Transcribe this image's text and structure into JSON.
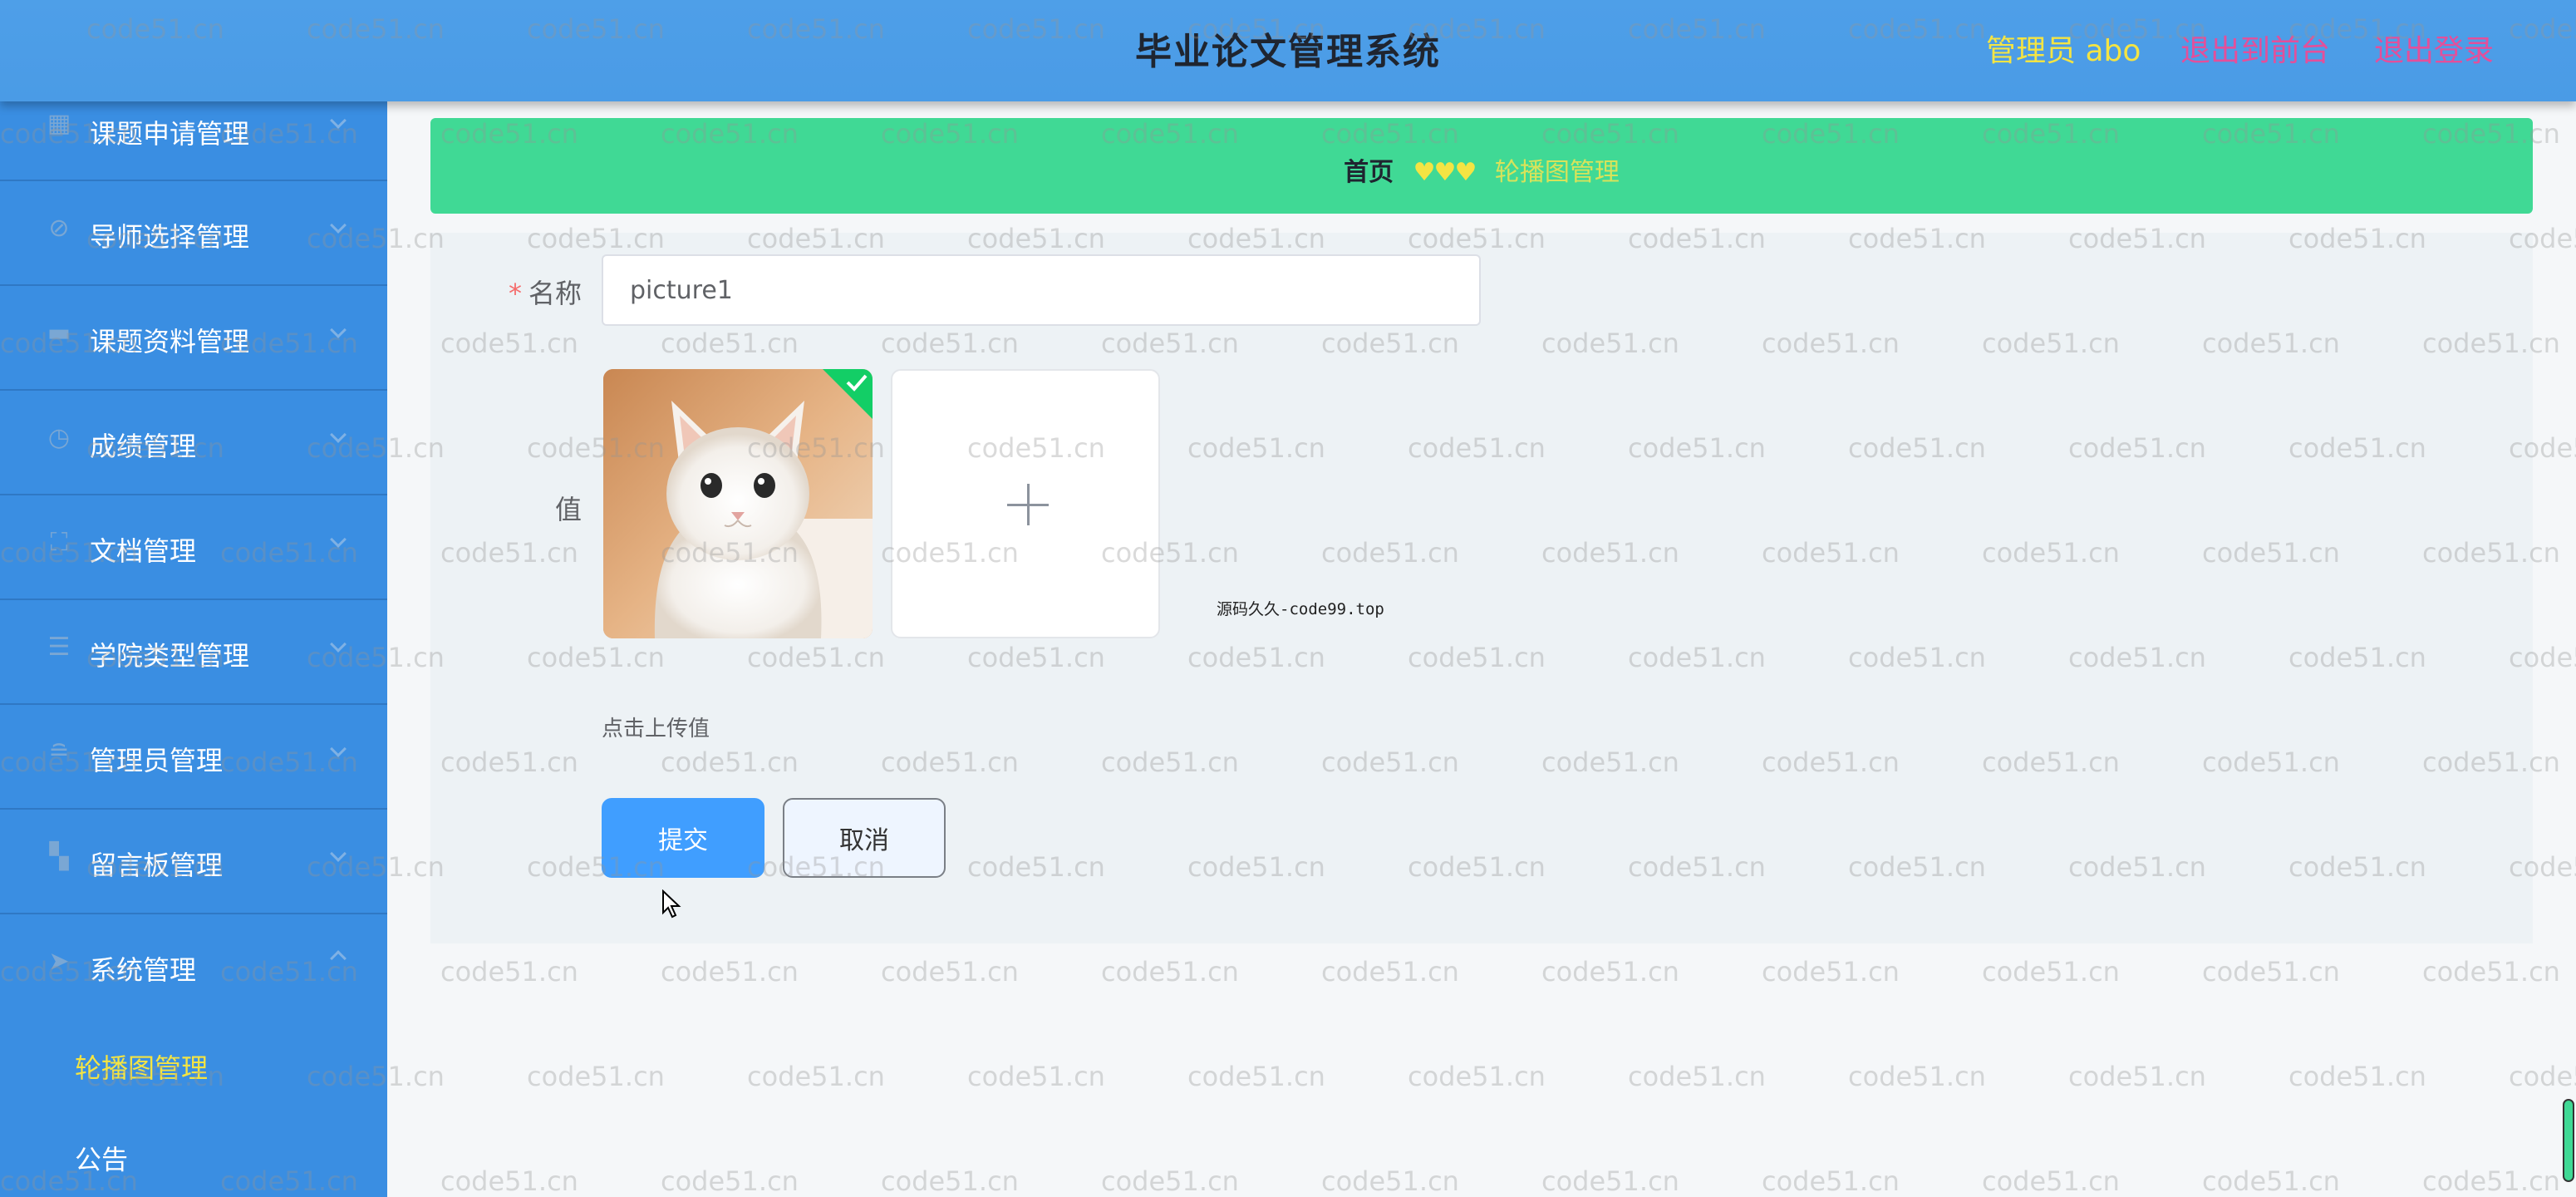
{
  "header": {
    "title": "毕业论文管理系统",
    "user": "管理员 abo",
    "back_front": "退出到前台",
    "logout": "退出登录"
  },
  "sidebar": {
    "items": [
      {
        "label": "课题申请管理",
        "icon": "building-icon"
      },
      {
        "label": "导师选择管理",
        "icon": "compass-icon"
      },
      {
        "label": "课题资料管理",
        "icon": "folder-icon"
      },
      {
        "label": "成绩管理",
        "icon": "clock-icon"
      },
      {
        "label": "文档管理",
        "icon": "document-icon"
      },
      {
        "label": "学院类型管理",
        "icon": "list-icon"
      },
      {
        "label": "管理员管理",
        "icon": "sliders-icon"
      },
      {
        "label": "留言板管理",
        "icon": "grid-icon"
      },
      {
        "label": "系统管理",
        "icon": "send-icon"
      }
    ],
    "submenu": [
      {
        "label": "轮播图管理",
        "active": true
      },
      {
        "label": "公告",
        "active": false
      }
    ]
  },
  "breadcrumb": {
    "home": "首页",
    "separator": "♥♥♥",
    "current": "轮播图管理"
  },
  "form": {
    "name_label": "名称",
    "required_mark": "*",
    "name_value": "picture1",
    "value_label": "值",
    "hint": "点击上传值",
    "source_note": "源码久久-code99.top",
    "submit": "提交",
    "cancel": "取消"
  },
  "watermark": "code51.cn",
  "colors": {
    "header": "#4a9be6",
    "sidebar": "#3a8ee2",
    "breadcrumb": "#40d995",
    "accent_yellow": "#f4e443",
    "accent_pink": "#e44f9a",
    "primary_button": "#409eff"
  }
}
